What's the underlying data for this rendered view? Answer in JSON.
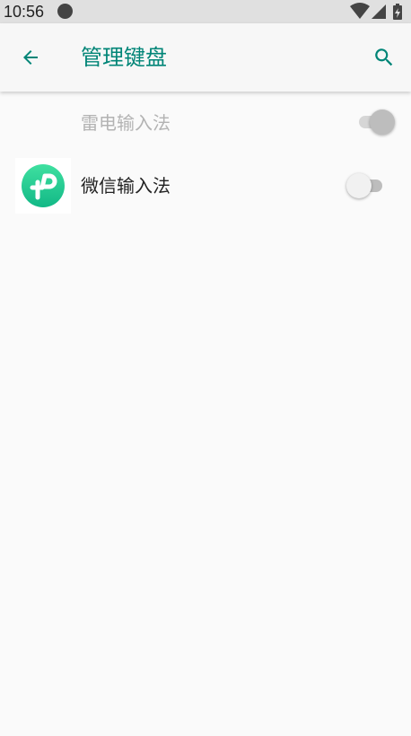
{
  "status_bar": {
    "time": "10:56",
    "icons": [
      "notification-dot-icon",
      "wifi-icon",
      "cell-signal-icon",
      "battery-charging-icon"
    ]
  },
  "app_bar": {
    "title": "管理键盘",
    "back_icon": "arrow-back-icon",
    "search_icon": "search-icon",
    "accent_color": "#008577"
  },
  "keyboards": [
    {
      "label": "雷电输入法",
      "enabled": true,
      "toggle_disabled": true,
      "icon": null
    },
    {
      "label": "微信输入法",
      "enabled": false,
      "toggle_disabled": false,
      "icon": "wechat-input-app-icon",
      "icon_gradient": [
        "#3fe0a0",
        "#12b886"
      ]
    }
  ]
}
